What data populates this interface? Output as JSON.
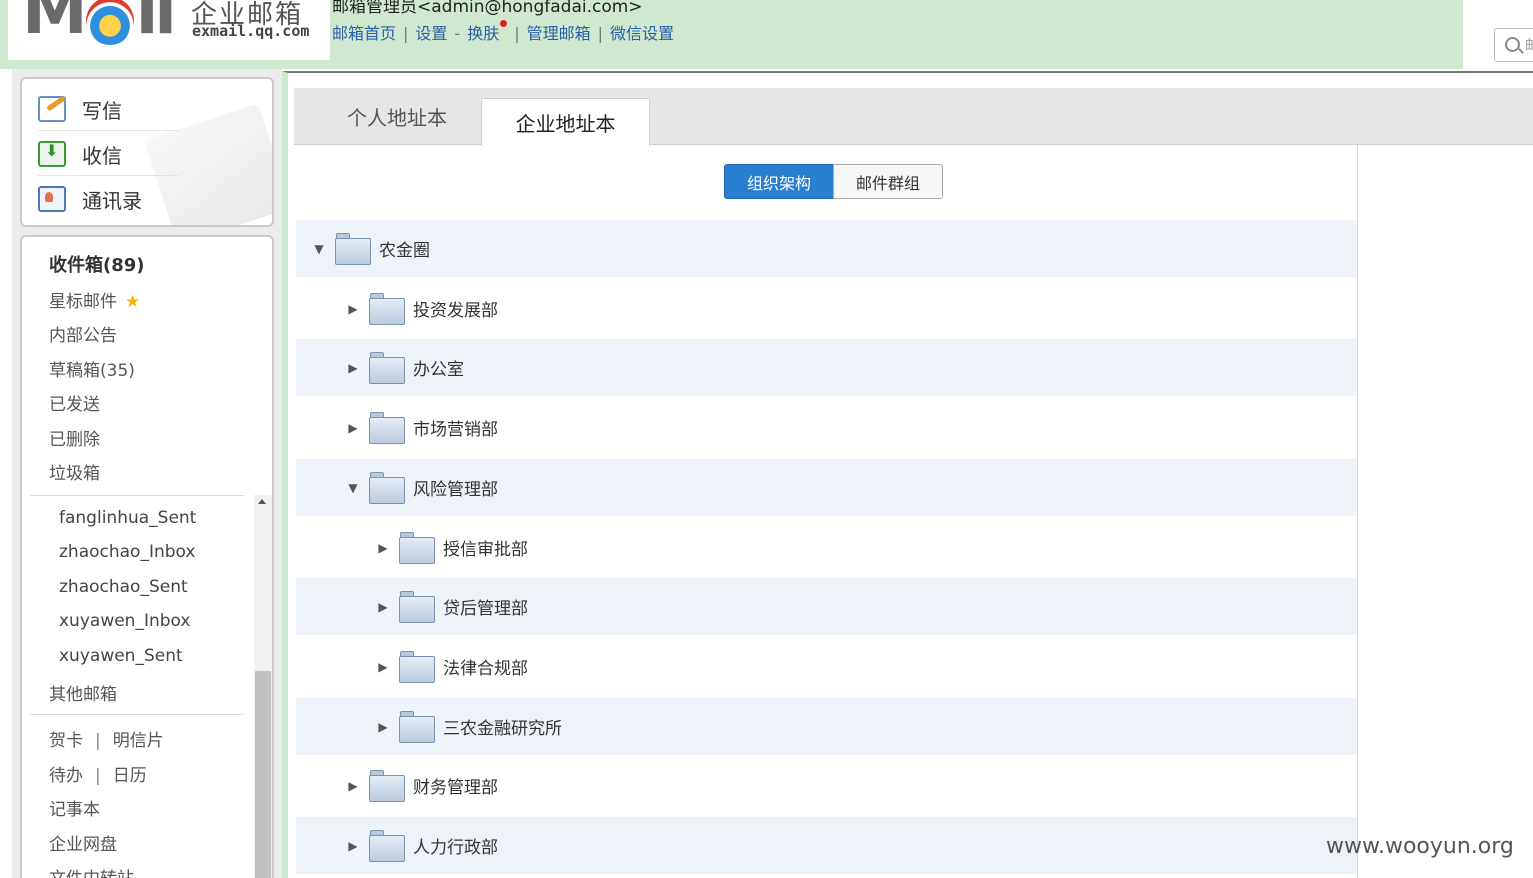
{
  "header": {
    "logo_mark": "Mail",
    "logo_text": "企业邮箱",
    "logo_sub": "exmail.qq.com",
    "admin_line": "邮箱管理员<admin@hongfadai.com>",
    "nav": [
      "邮箱首页",
      "设置",
      "换肤",
      "管理邮箱",
      "微信设置"
    ],
    "nav_sep": "|",
    "nav_dash": "-",
    "search_placeholder": "邮"
  },
  "actions": [
    {
      "label": "写信",
      "icon": "write-icon"
    },
    {
      "label": "收信",
      "icon": "inbox-icon"
    },
    {
      "label": "通讯录",
      "icon": "contacts-icon"
    }
  ],
  "folders": {
    "inbox": "收件箱(89)",
    "starred": "星标邮件",
    "notice": "内部公告",
    "drafts": "草稿箱(35)",
    "sent": "已发送",
    "deleted": "已删除",
    "junk": "垃圾箱",
    "sub": [
      "fanglinhua_Sent",
      "zhaochao_Inbox",
      "zhaochao_Sent",
      "xuyawen_Inbox",
      "xuyawen_Sent"
    ],
    "other": "其他邮箱"
  },
  "tools": {
    "row1": [
      "贺卡",
      "明信片"
    ],
    "row2": [
      "待办",
      "日历"
    ],
    "notes": "记事本",
    "disk": "企业网盘",
    "transfer": "文件中转站",
    "sep": "|"
  },
  "tabs": {
    "personal": "个人地址本",
    "enterprise": "企业地址本"
  },
  "segments": {
    "org": "组织架构",
    "group": "邮件群组"
  },
  "tree": [
    {
      "label": "农金圈",
      "level": 0,
      "expanded": true
    },
    {
      "label": "投资发展部",
      "level": 1,
      "expanded": false
    },
    {
      "label": "办公室",
      "level": 1,
      "expanded": false
    },
    {
      "label": "市场营销部",
      "level": 1,
      "expanded": false
    },
    {
      "label": "风险管理部",
      "level": 1,
      "expanded": true
    },
    {
      "label": "授信审批部",
      "level": 2,
      "expanded": false
    },
    {
      "label": "贷后管理部",
      "level": 2,
      "expanded": false
    },
    {
      "label": "法律合规部",
      "level": 2,
      "expanded": false
    },
    {
      "label": "三农金融研究所",
      "level": 2,
      "expanded": false
    },
    {
      "label": "财务管理部",
      "level": 1,
      "expanded": false
    },
    {
      "label": "人力行政部",
      "level": 1,
      "expanded": false
    }
  ],
  "glyphs": {
    "expanded": "▼",
    "collapsed": "▶",
    "star": "★"
  },
  "watermark": "www.wooyun.org",
  "colors": {
    "header_bg": "#cfe8cf",
    "accent": "#2b7fd0",
    "row_shade": "#eef2f9",
    "link": "#2a5fa5"
  }
}
